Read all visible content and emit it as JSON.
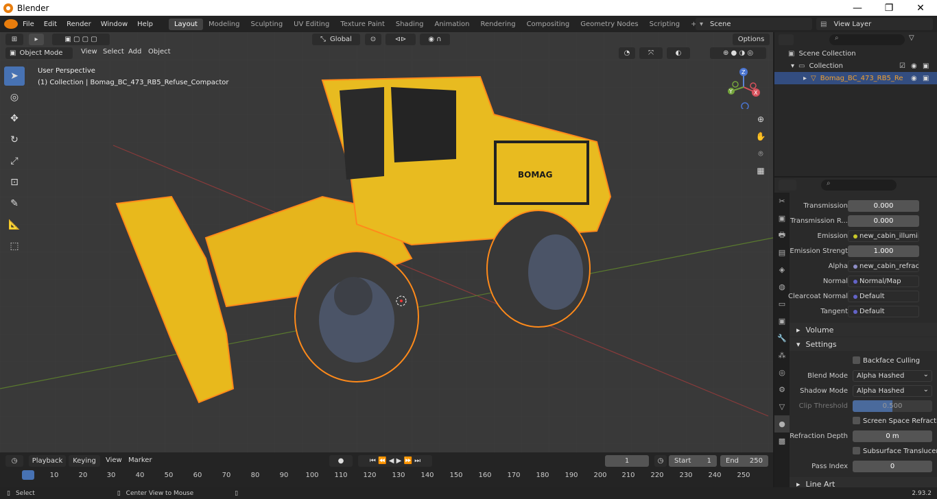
{
  "window": {
    "title": "Blender",
    "minimize": "—",
    "maximize": "❐",
    "close": "✕"
  },
  "menus": [
    "File",
    "Edit",
    "Render",
    "Window",
    "Help"
  ],
  "workspaces": [
    "Layout",
    "Modeling",
    "Sculpting",
    "UV Editing",
    "Texture Paint",
    "Shading",
    "Animation",
    "Rendering",
    "Compositing",
    "Geometry Nodes",
    "Scripting"
  ],
  "scene": {
    "name": "Scene",
    "view_layer": "View Layer"
  },
  "viewport": {
    "mode": "Object Mode",
    "menus": [
      "View",
      "Select",
      "Add",
      "Object"
    ],
    "transform_orientation": "Global",
    "options": "Options",
    "overlay_title": "User Perspective",
    "overlay_collection": "(1) Collection | Bomag_BC_473_RB5_Refuse_Compactor",
    "gizmo": {
      "x": "X",
      "y": "Y",
      "z": "Z"
    }
  },
  "outliner": {
    "items": [
      {
        "label": "Scene Collection"
      },
      {
        "label": "Collection"
      },
      {
        "label": "Bomag_BC_473_RB5_Re"
      }
    ]
  },
  "properties": {
    "rows": [
      {
        "label": "Transmission",
        "value": "0.000"
      },
      {
        "label": "Transmission R...",
        "value": "0.000"
      },
      {
        "label": "Emission",
        "value": "new_cabin_illuminat..."
      },
      {
        "label": "Emission Strengt",
        "value": "1.000"
      },
      {
        "label": "Alpha",
        "value": "new_cabin_refract_i..."
      },
      {
        "label": "Normal",
        "value": "Normal/Map"
      },
      {
        "label": "Clearcoat Normal",
        "value": "Default"
      },
      {
        "label": "Tangent",
        "value": "Default"
      }
    ],
    "sections": {
      "volume": "Volume",
      "settings": "Settings",
      "line_art": "Line Art"
    },
    "settings": {
      "backface_culling": "Backface Culling",
      "blend_mode_label": "Blend Mode",
      "blend_mode": "Alpha Hashed",
      "shadow_mode_label": "Shadow Mode",
      "shadow_mode": "Alpha Hashed",
      "clip_threshold_label": "Clip Threshold",
      "clip_threshold": "0.500",
      "ssr": "Screen Space Refraction",
      "refraction_depth_label": "Refraction Depth",
      "refraction_depth": "0 m",
      "subsurface": "Subsurface Translucency",
      "pass_index_label": "Pass Index",
      "pass_index": "0"
    }
  },
  "timeline": {
    "menus": [
      "Playback",
      "Keying",
      "View",
      "Marker"
    ],
    "current_frame": "1",
    "start_label": "Start",
    "start": "1",
    "end_label": "End",
    "end": "250",
    "ticks": [
      "1",
      "10",
      "20",
      "30",
      "40",
      "50",
      "60",
      "70",
      "80",
      "90",
      "100",
      "110",
      "120",
      "130",
      "140",
      "150",
      "160",
      "170",
      "180",
      "190",
      "200",
      "210",
      "220",
      "230",
      "240",
      "250"
    ]
  },
  "status": {
    "select": "Select",
    "center": "Center View to Mouse",
    "version": "2.93.2"
  }
}
